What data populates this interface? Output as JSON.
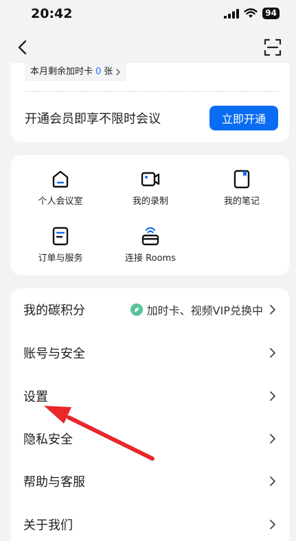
{
  "status_bar": {
    "time": "20:42",
    "battery": "94"
  },
  "member": {
    "extra_prefix": "本月剩余加时卡",
    "extra_count": "0",
    "extra_suffix": "张",
    "promo_text": "开通会员即享不限时会议",
    "open_button": "立即开通"
  },
  "grid": {
    "items": [
      {
        "label": "个人会议室",
        "icon": "home-icon"
      },
      {
        "label": "我的录制",
        "icon": "video-camera-icon"
      },
      {
        "label": "我的笔记",
        "icon": "notebook-icon"
      },
      {
        "label": "订单与服务",
        "icon": "order-icon"
      },
      {
        "label": "连接 Rooms",
        "icon": "rooms-wifi-icon"
      }
    ]
  },
  "list": {
    "items": [
      {
        "label": "我的碳积分",
        "right": "加时卡、视频VIP兑换中"
      },
      {
        "label": "账号与安全",
        "right": ""
      },
      {
        "label": "设置",
        "right": ""
      },
      {
        "label": "隐私安全",
        "right": ""
      },
      {
        "label": "帮助与客服",
        "right": ""
      },
      {
        "label": "关于我们",
        "right": ""
      }
    ]
  },
  "colors": {
    "accent": "#0a6cf2",
    "arrow": "#e8282b",
    "badge": "#57c59a"
  }
}
